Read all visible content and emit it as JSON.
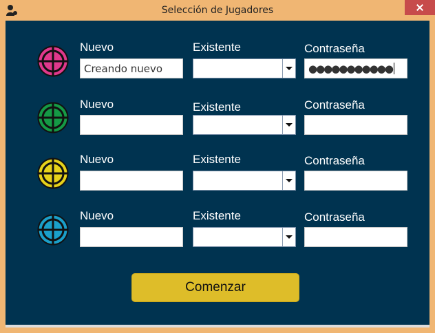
{
  "window": {
    "title": "Selección de Jugadores"
  },
  "players": [
    {
      "color": "#e0388c",
      "new_label": "Nuevo",
      "new_value": "Creando nuevo",
      "existing_label": "Existente",
      "password_label": "Contraseña",
      "password_value": "●●●●●●●●●●●"
    },
    {
      "color": "#159a45",
      "new_label": "Nuevo",
      "new_value": "",
      "existing_label": "Existente",
      "password_label": "Contraseña",
      "password_value": ""
    },
    {
      "color": "#e6d21a",
      "new_label": "Nuevo",
      "new_value": "",
      "existing_label": "Existente",
      "password_label": "Contraseña",
      "password_value": ""
    },
    {
      "color": "#1a9fc9",
      "new_label": "Nuevo",
      "new_value": "",
      "existing_label": "Existente",
      "password_label": "Contraseña",
      "password_value": ""
    }
  ],
  "start_button": "Comenzar",
  "icons": {
    "app": "player-silhouette-icon",
    "close": "close-icon",
    "token": "crosshair-token-icon",
    "dropdown": "chevron-down-icon"
  }
}
